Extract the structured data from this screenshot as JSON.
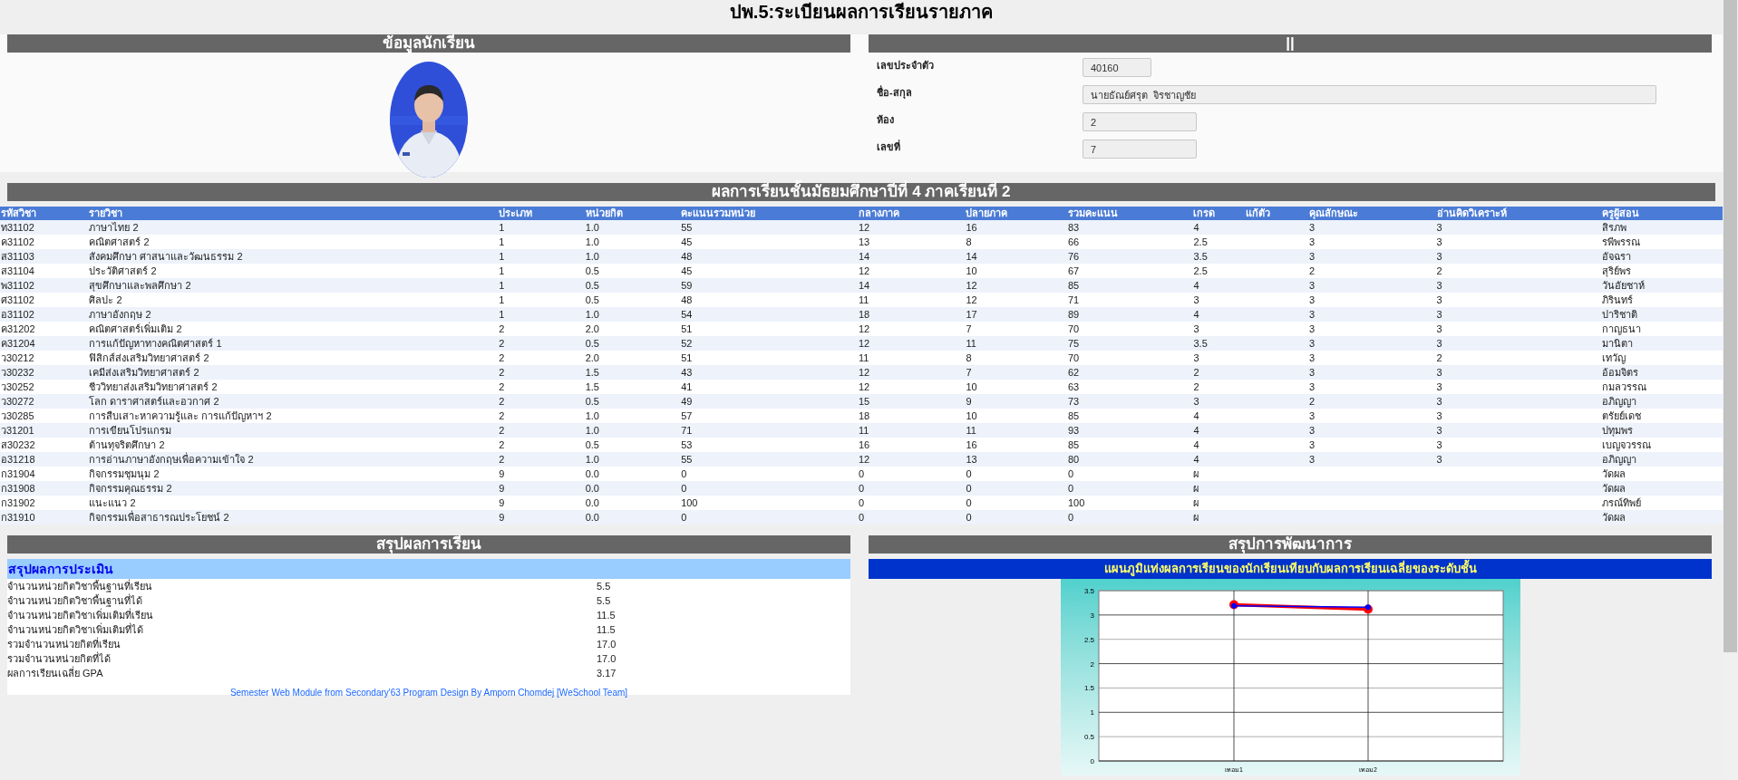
{
  "title": "ปพ.5:ระเบียนผลการเรียนรายภาค",
  "student_panel": {
    "header": "ข้อมูลนักเรียน"
  },
  "info_panel": {
    "header": "||",
    "fields": [
      {
        "label": "เลขประจำตัว",
        "value": "40160"
      },
      {
        "label": "ชื่อ-สกุล",
        "value": "นายธัณย์ศรุต  จิรชาญชัย"
      },
      {
        "label": "ห้อง",
        "value": "2"
      },
      {
        "label": "เลขที่",
        "value": "7"
      }
    ]
  },
  "results": {
    "header": "ผลการเรียนชั้นมัธยมศึกษาปีที่ 4 ภาคเรียนที่ 2",
    "columns": [
      "รหัสวิชา",
      "รายวิชา",
      "ประเภท",
      "หน่วยกิต",
      "คะแนนรวมหน่วย",
      "กลางภาค",
      "ปลายภาค",
      "รวมคะแนน",
      "เกรด",
      "แก้ตัว",
      "คุณลักษณะ",
      "อ่านคิดวิเคราะห์",
      "ครูผู้สอน"
    ],
    "rows": [
      [
        "ท31102",
        "ภาษาไทย 2",
        "1",
        "1.0",
        "55",
        "12",
        "16",
        "83",
        "4",
        "",
        "3",
        "3",
        "สิรภพ"
      ],
      [
        "ค31102",
        "คณิตศาสตร์ 2",
        "1",
        "1.0",
        "45",
        "13",
        "8",
        "66",
        "2.5",
        "",
        "3",
        "3",
        "รพีพรรณ"
      ],
      [
        "ส31103",
        "สังคมศึกษา ศาสนาและวัฒนธรรม 2",
        "1",
        "1.0",
        "48",
        "14",
        "14",
        "76",
        "3.5",
        "",
        "3",
        "3",
        "อัจฉรา"
      ],
      [
        "ส31104",
        "ประวัติศาสตร์ 2",
        "1",
        "0.5",
        "45",
        "12",
        "10",
        "67",
        "2.5",
        "",
        "2",
        "2",
        "สุริย์พร"
      ],
      [
        "พ31102",
        "สุขศึกษาและพลศึกษา 2",
        "1",
        "0.5",
        "59",
        "14",
        "12",
        "85",
        "4",
        "",
        "3",
        "3",
        "วันอัยชาห์"
      ],
      [
        "ศ31102",
        "ศิลปะ 2",
        "1",
        "0.5",
        "48",
        "11",
        "12",
        "71",
        "3",
        "",
        "3",
        "3",
        "ภิรินทร์"
      ],
      [
        "อ31102",
        "ภาษาอังกฤษ 2",
        "1",
        "1.0",
        "54",
        "18",
        "17",
        "89",
        "4",
        "",
        "3",
        "3",
        "ปาริชาติ"
      ],
      [
        "ค31202",
        "คณิตศาสตร์เพิ่มเติม 2",
        "2",
        "2.0",
        "51",
        "12",
        "7",
        "70",
        "3",
        "",
        "3",
        "3",
        "กาญธนา"
      ],
      [
        "ค31204",
        "การแก้ปัญหาทางคณิตศาสตร์ 1",
        "2",
        "0.5",
        "52",
        "12",
        "11",
        "75",
        "3.5",
        "",
        "3",
        "3",
        "มานิตา"
      ],
      [
        "ว30212",
        "ฟิสิกส์ส่งเสริมวิทยาศาสตร์ 2",
        "2",
        "2.0",
        "51",
        "11",
        "8",
        "70",
        "3",
        "",
        "3",
        "2",
        "เทวัญ"
      ],
      [
        "ว30232",
        "เคมีส่งเสริมวิทยาศาสตร์ 2",
        "2",
        "1.5",
        "43",
        "12",
        "7",
        "62",
        "2",
        "",
        "3",
        "3",
        "อ้อมจิตร"
      ],
      [
        "ว30252",
        "ชีววิทยาส่งเสริมวิทยาศาสตร์ 2",
        "2",
        "1.5",
        "41",
        "12",
        "10",
        "63",
        "2",
        "",
        "3",
        "3",
        "กมลวรรณ"
      ],
      [
        "ว30272",
        "โลก ดาราศาสตร์และอวกาศ 2",
        "2",
        "0.5",
        "49",
        "15",
        "9",
        "73",
        "3",
        "",
        "2",
        "3",
        "อภิญญา"
      ],
      [
        "ว30285",
        "การสืบเสาะหาความรู้และ การแก้ปัญหาฯ 2",
        "2",
        "1.0",
        "57",
        "18",
        "10",
        "85",
        "4",
        "",
        "3",
        "3",
        "ตรัยย์เดช"
      ],
      [
        "ว31201",
        "การเขียนโปรแกรม",
        "2",
        "1.0",
        "71",
        "11",
        "11",
        "93",
        "4",
        "",
        "3",
        "3",
        "ปทุมพร"
      ],
      [
        "ส30232",
        "ต้านทุจริตศึกษา 2",
        "2",
        "0.5",
        "53",
        "16",
        "16",
        "85",
        "4",
        "",
        "3",
        "3",
        "เบญจวรรณ"
      ],
      [
        "อ31218",
        "การอ่านภาษาอังกฤษเพื่อความเข้าใจ 2",
        "2",
        "1.0",
        "55",
        "12",
        "13",
        "80",
        "4",
        "",
        "3",
        "3",
        "อภิญญา"
      ],
      [
        "ก31904",
        "กิจกรรมชุมนุม 2",
        "9",
        "0.0",
        "0",
        "0",
        "0",
        "0",
        "ผ",
        "",
        "",
        "",
        "วัดผล"
      ],
      [
        "ก31908",
        "กิจกรรมคุณธรรม 2",
        "9",
        "0.0",
        "0",
        "0",
        "0",
        "0",
        "ผ",
        "",
        "",
        "",
        "วัดผล"
      ],
      [
        "ก31902",
        "แนะแนว 2",
        "9",
        "0.0",
        "100",
        "0",
        "0",
        "100",
        "ผ",
        "",
        "",
        "",
        "ภรณ์ทิพย์"
      ],
      [
        "ก31910",
        "กิจกรรมเพื่อสาธารณประโยชน์ 2",
        "9",
        "0.0",
        "0",
        "0",
        "0",
        "0",
        "ผ",
        "",
        "",
        "",
        "วัดผล"
      ]
    ]
  },
  "summary": {
    "header": "สรุปผลการเรียน",
    "subheader": "สรุปผลการประเมิน",
    "items": [
      {
        "label": "จำนวนหน่วยกิตวิชาพื้นฐานที่เรียน",
        "value": "5.5"
      },
      {
        "label": "จำนวนหน่วยกิตวิชาพื้นฐานที่ได้",
        "value": "5.5"
      },
      {
        "label": "จำนวนหน่วยกิตวิชาเพิ่มเติมที่เรียน",
        "value": "11.5"
      },
      {
        "label": "จำนวนหน่วยกิตวิชาเพิ่มเติมที่ได้",
        "value": "11.5"
      },
      {
        "label": "รวมจำนวนหน่วยกิตที่เรียน",
        "value": "17.0"
      },
      {
        "label": "รวมจำนวนหน่วยกิตที่ได้",
        "value": "17.0"
      },
      {
        "label": "ผลการเรียนเฉลี่ย GPA",
        "value": "3.17"
      }
    ],
    "footer": "Semester Web Module from Secondary'63 Program Design By Amporn Chomdej [WeSchool Team]"
  },
  "development": {
    "header": "สรุปการพัฒนาการ",
    "chart_title": "แผนภูมิแท่งผลการเรียนของนักเรียนเทียบกับผลการเรียนเฉลี่ยของระดับชั้น",
    "chart_data": {
      "type": "line",
      "grid": true,
      "categories": [
        "เทอม1",
        "เทอม2"
      ],
      "ylim": [
        0,
        3.5
      ],
      "yticks": [
        0,
        0.5,
        1,
        1.5,
        2,
        2.5,
        3,
        3.5
      ],
      "series": [
        {
          "color": "#ff0000",
          "marker": "circle",
          "values": [
            3.21,
            3.12
          ]
        },
        {
          "color": "#0000ff",
          "marker": "circle",
          "values": [
            3.19,
            3.16
          ]
        }
      ]
    }
  }
}
